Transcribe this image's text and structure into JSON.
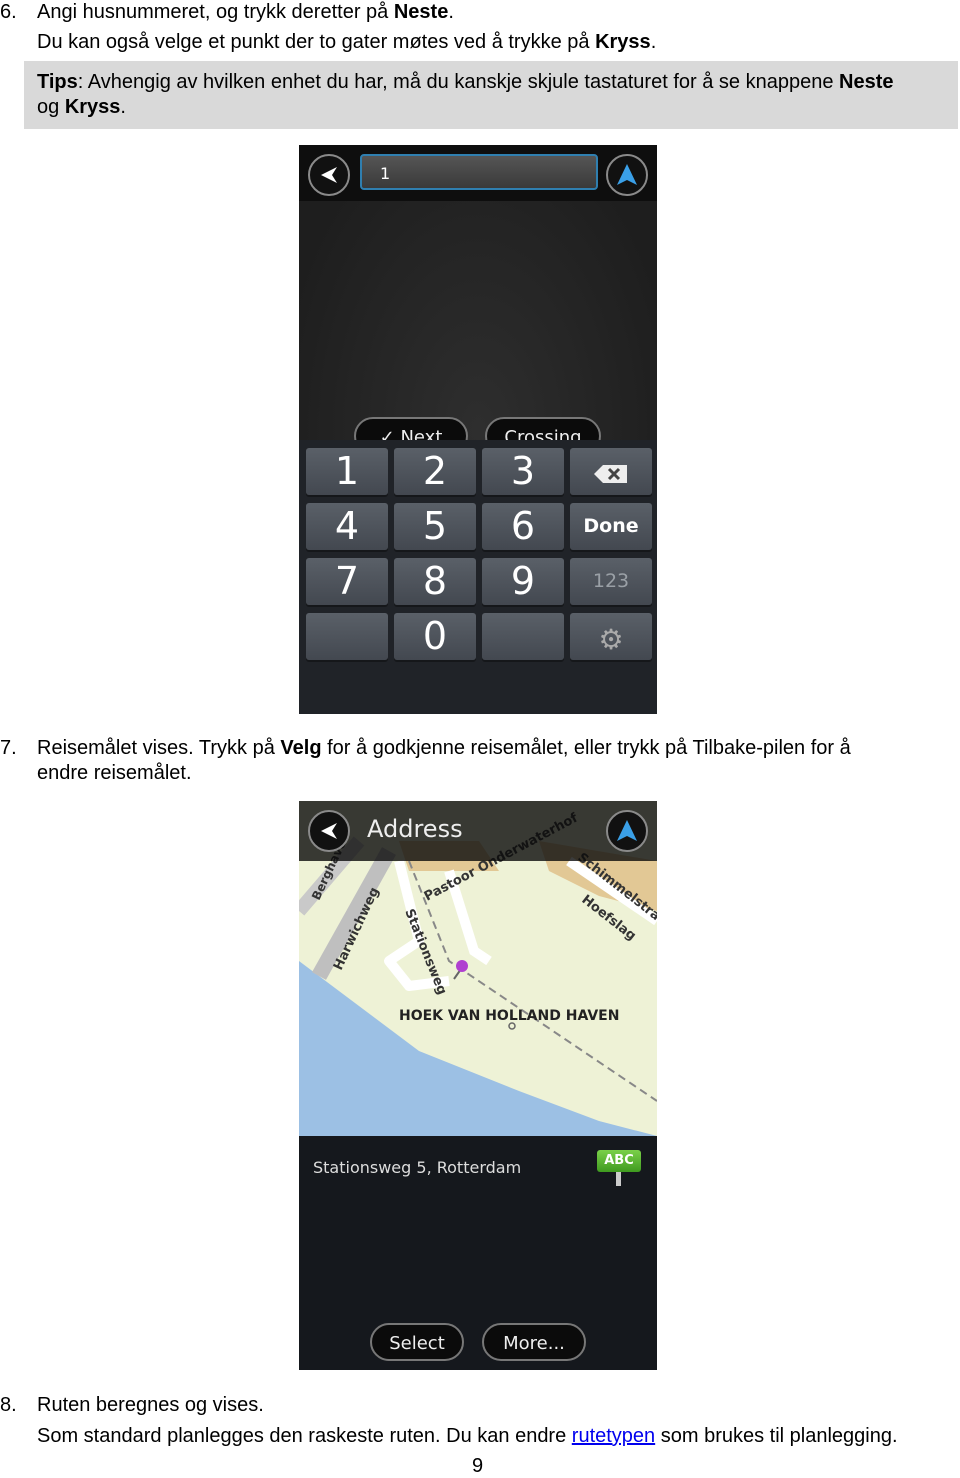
{
  "step6": {
    "number": "6.",
    "line1_pre": "Angi husnummeret, og trykk deretter på ",
    "line1_bold": "Neste",
    "line1_post": ".",
    "line2_pre": "Du kan også velge et punkt der to gater møtes ved å trykke på ",
    "line2_bold": "Kryss",
    "line2_post": "."
  },
  "tips": {
    "label": "Tips",
    "text1": ": Avhengig av hvilken enhet du har, må du kanskje skjule tastaturet for å se knappene ",
    "bold1": "Neste",
    "text2": "og ",
    "bold2": "Kryss",
    "text3": "."
  },
  "screen1": {
    "input_value": "1",
    "next_label": "Next",
    "crossing_label": "Crossing",
    "keys": [
      "1",
      "2",
      "3",
      "",
      "4",
      "5",
      "6",
      "Done",
      "7",
      "8",
      "9",
      "123",
      "",
      "0",
      "",
      ""
    ],
    "accent": "#2f7fb0"
  },
  "step7": {
    "number": "7.",
    "pre": "Reisemålet vises. Trykk på ",
    "bold": "Velg",
    "post": " for å godkjenne reisemålet, eller trykk på Tilbake-pilen for å",
    "line2": "endre reisemålet."
  },
  "screen2": {
    "title": "Address",
    "map_labels": [
      "Berghaven",
      "Harwichweg",
      "Stationsweg",
      "Pastoor Onderwaterhof",
      "Schimmelstraat",
      "Hoefslag",
      "HOEK VAN HOLLAND HAVEN"
    ],
    "address": "Stationsweg 5, Rotterdam",
    "sign_label": "ABC",
    "select_label": "Select",
    "more_label": "More..."
  },
  "step8": {
    "number": "8.",
    "line1": "Ruten beregnes og vises.",
    "line2_pre": "Som standard planlegges den raskeste ruten. Du kan endre ",
    "link": "rutetypen",
    "line2_post": " som brukes til planlegging."
  },
  "page_number": "9"
}
